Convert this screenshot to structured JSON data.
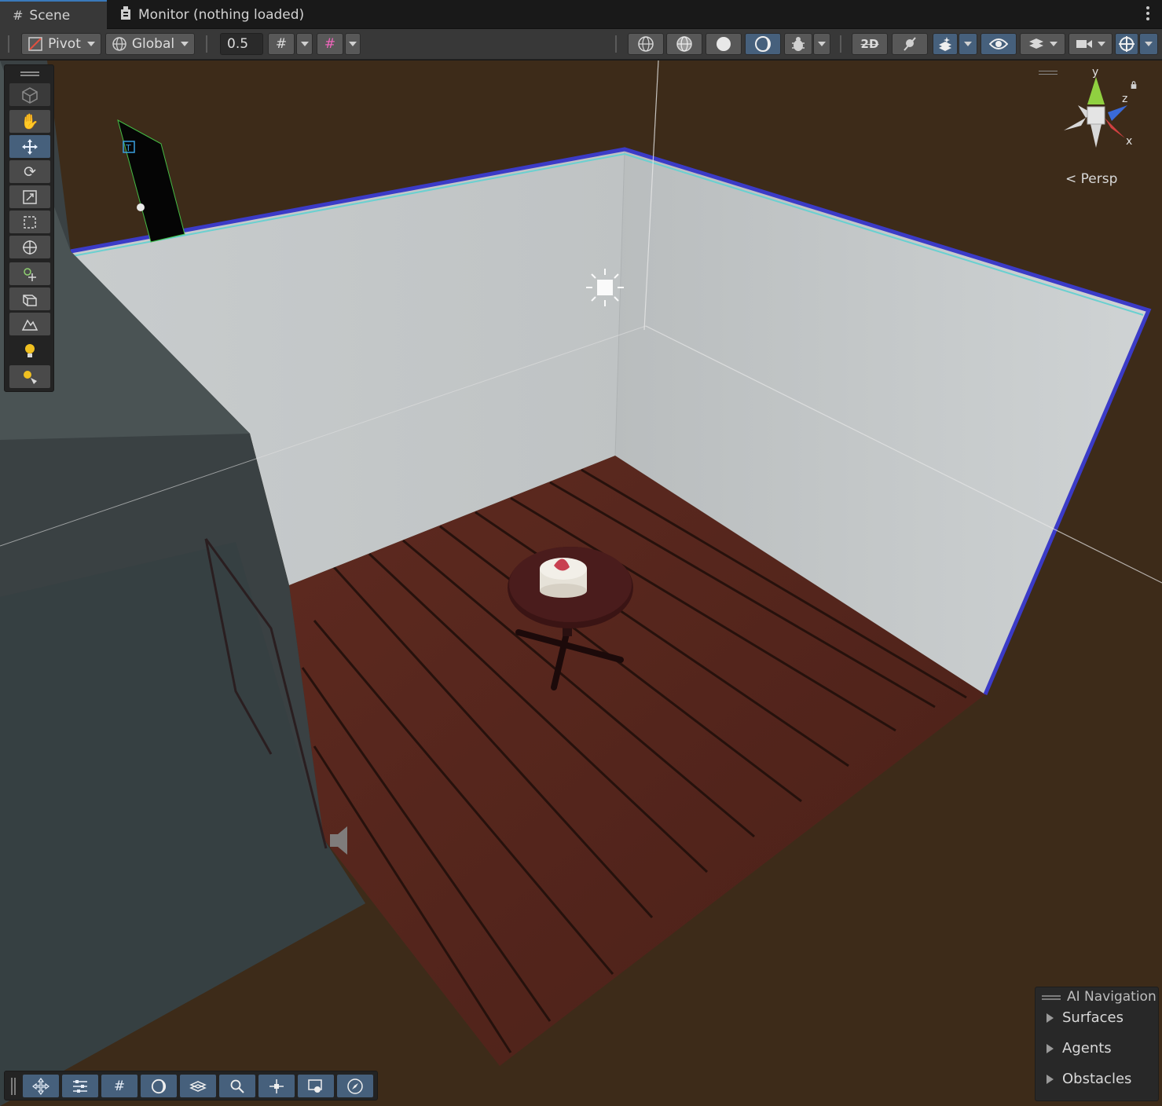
{
  "tabs": [
    {
      "label": "Scene",
      "icon": "grid-hash-icon",
      "active": true
    },
    {
      "label": "Monitor (nothing loaded)",
      "icon": "monitor-icon",
      "active": false
    }
  ],
  "toolbar": {
    "pivot_label": "Pivot",
    "global_label": "Global",
    "snap_value": "0.5"
  },
  "viewport": {
    "projection_label": "< Persp",
    "axis_labels": {
      "x": "x",
      "y": "y",
      "z": "z"
    }
  },
  "ai_navigation": {
    "title": "AI Navigation",
    "items": [
      "Surfaces",
      "Agents",
      "Obstacles"
    ]
  },
  "colors": {
    "accent": "#46607c",
    "selection_outline": "#3b3bc7",
    "floor": "#5a2a20",
    "wall": "#c9cdce",
    "background": "#3d2b19"
  }
}
